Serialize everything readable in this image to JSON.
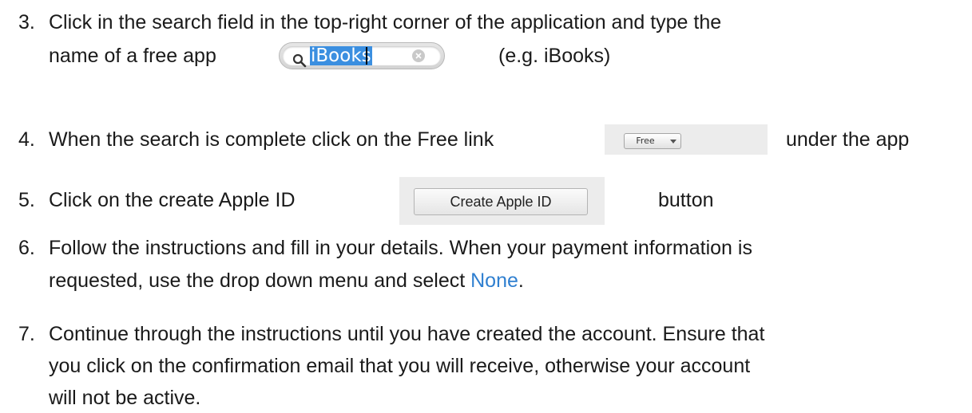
{
  "steps": [
    {
      "number": "3.",
      "line1": "Click in the search field in the top-right corner of the application and type the",
      "line2_before": "name of a free app",
      "line2_after": "(e.g. iBooks)"
    },
    {
      "number": "4.",
      "before": "When the search is complete click on the Free link",
      "after": "under the app"
    },
    {
      "number": "5.",
      "before": "Click on the create Apple ID",
      "after": "button"
    },
    {
      "number": "6.",
      "line1": "Follow the instructions and fill in your details. When your payment information is",
      "line2_before": "requested, use the drop down menu and select ",
      "line2_highlight": "None",
      "line2_after": "."
    },
    {
      "number": "7.",
      "line1": "Continue through the instructions until you have created the account. Ensure that",
      "line2": "you click on the confirmation email that you will receive, otherwise your account",
      "line3": "will not be active."
    }
  ],
  "search_field": {
    "value": "iBooks",
    "icon": "search-icon",
    "clear_icon": "clear-icon"
  },
  "free_button": {
    "label": "Free",
    "dropdown_icon": "chevron-down-icon"
  },
  "create_apple_id_button": {
    "label": "Create Apple ID"
  },
  "colors": {
    "text": "#1a1a1a",
    "link_accent": "#2f7fd0",
    "selection": "#3b8fe0"
  }
}
